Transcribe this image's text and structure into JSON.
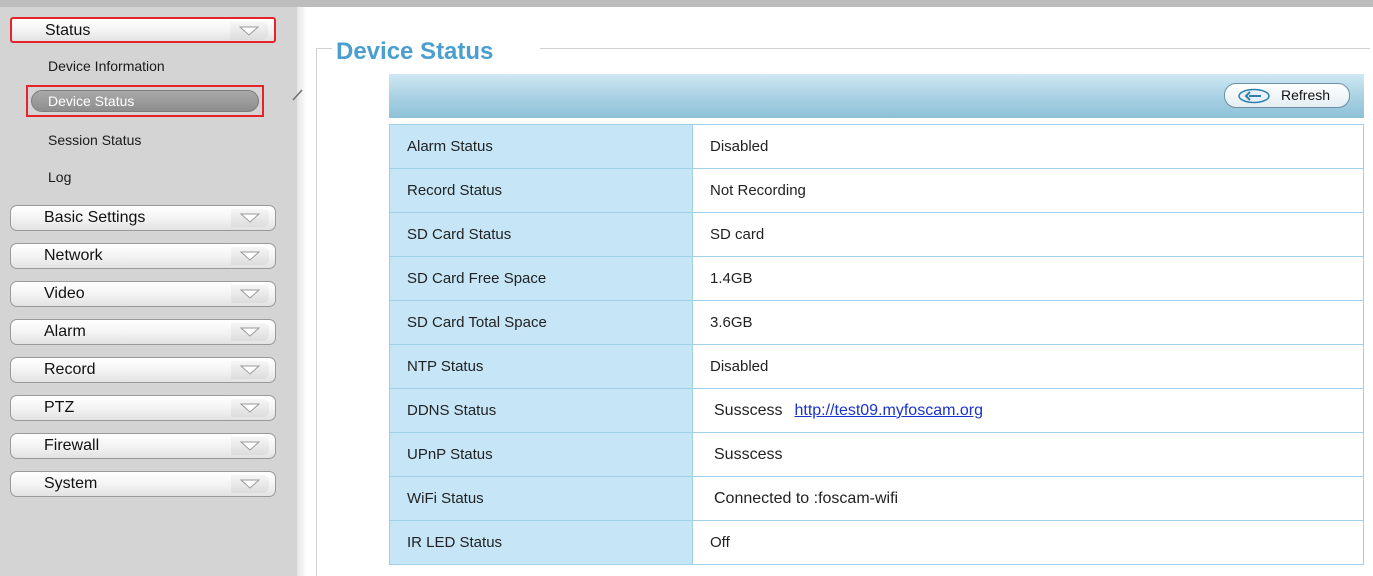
{
  "sidebar": {
    "status_menu": "Status",
    "status_items": [
      "Device Information",
      "Device Status",
      "Session Status",
      "Log"
    ],
    "menus": [
      "Basic Settings",
      "Network",
      "Video",
      "Alarm",
      "Record",
      "PTZ",
      "Firewall",
      "System"
    ]
  },
  "main": {
    "title": "Device Status",
    "refresh_label": "Refresh",
    "rows": [
      {
        "label": "Alarm Status",
        "value": "Disabled"
      },
      {
        "label": "Record Status",
        "value": "Not Recording"
      },
      {
        "label": "SD Card Status",
        "value": "SD card"
      },
      {
        "label": "SD Card Free Space",
        "value": "1.4GB"
      },
      {
        "label": "SD Card Total Space",
        "value": "3.6GB"
      },
      {
        "label": "NTP Status",
        "value": "Disabled"
      },
      {
        "label": "DDNS Status",
        "value": "Susscess",
        "link": "http://test09.myfoscam.org"
      },
      {
        "label": "UPnP Status",
        "value": "Susscess"
      },
      {
        "label": "WiFi Status",
        "value": "Connected to :foscam-wifi"
      },
      {
        "label": "IR LED Status",
        "value": "Off"
      }
    ]
  },
  "colors": {
    "accent_title": "#4a9fd0",
    "highlight_border": "#e4242a",
    "table_key_bg": "#c6e6f7",
    "link": "#1a33cc"
  }
}
